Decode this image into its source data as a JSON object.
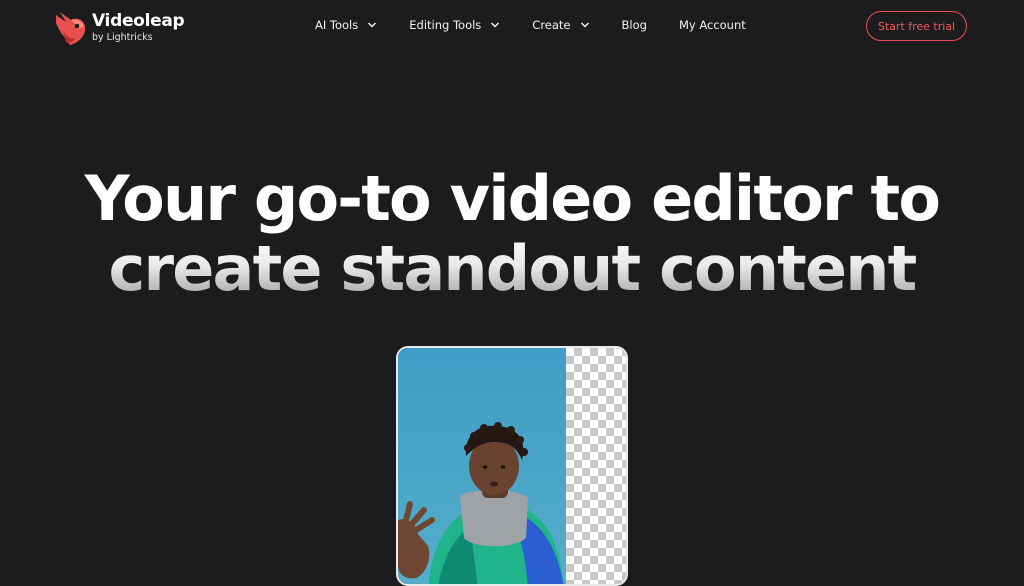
{
  "brand": {
    "name": "Videoleap",
    "byline": "by Lightricks",
    "logo_icon": "videoleap-bird-logo",
    "accent_color": "#f05a57"
  },
  "nav": {
    "items": [
      {
        "label": "AI Tools",
        "dropdown": true
      },
      {
        "label": "Editing Tools",
        "dropdown": true
      },
      {
        "label": "Create",
        "dropdown": true
      },
      {
        "label": "Blog",
        "dropdown": false
      },
      {
        "label": "My Account",
        "dropdown": false
      }
    ],
    "cta_label": "Start free trial"
  },
  "hero": {
    "headline_line1": "Your go-to video editor to",
    "headline_line2": "create standout content"
  },
  "preview": {
    "description_icon": "background-removal-preview"
  },
  "colors": {
    "background": "#1c1c1e",
    "text": "#ffffff",
    "cta_border": "#e8514f"
  }
}
